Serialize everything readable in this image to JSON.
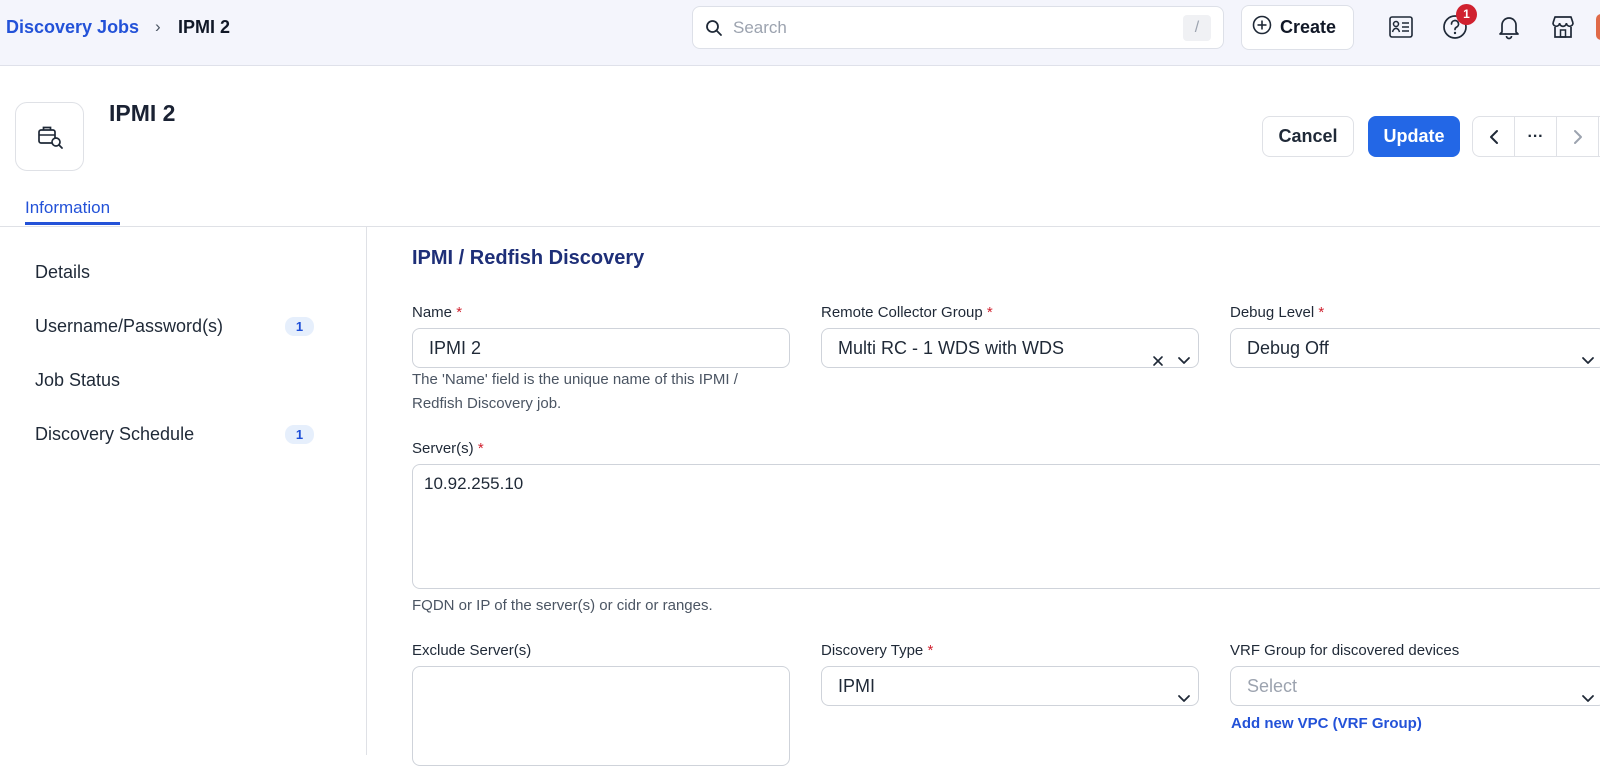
{
  "breadcrumb": {
    "root": "Discovery Jobs",
    "separator": "›",
    "current": "IPMI 2"
  },
  "search": {
    "placeholder": "Search",
    "shortcut": "/"
  },
  "header_actions": {
    "create_label": "Create",
    "help_badge": "1",
    "icons": [
      "report-icon",
      "help-icon",
      "bell-icon",
      "store-icon",
      "avatar"
    ]
  },
  "page": {
    "title": "IPMI 2",
    "cancel_label": "Cancel",
    "update_label": "Update",
    "more_label": "···"
  },
  "tabs": [
    {
      "label": "Information",
      "active": true
    }
  ],
  "sidebar": {
    "items": [
      {
        "label": "Details",
        "count": ""
      },
      {
        "label": "Username/Password(s)",
        "count": "1"
      },
      {
        "label": "Job Status",
        "count": ""
      },
      {
        "label": "Discovery Schedule",
        "count": "1"
      }
    ]
  },
  "form": {
    "section_title": "IPMI / Redfish Discovery",
    "required_mark": "*",
    "name": {
      "label": "Name",
      "value": "IPMI 2",
      "help": "The 'Name' field is the unique name of this IPMI /",
      "help2": "Redfish Discovery job."
    },
    "remote_collector_group": {
      "label": "Remote Collector Group",
      "value": "Multi RC - 1 WDS with WDS"
    },
    "debug_level": {
      "label": "Debug Level",
      "value": "Debug Off"
    },
    "servers": {
      "label": "Server(s)",
      "value": "10.92.255.10",
      "help": "FQDN or IP of the server(s) or cidr or ranges."
    },
    "exclude_servers": {
      "label": "Exclude Server(s)",
      "value": ""
    },
    "discovery_type": {
      "label": "Discovery Type",
      "value": "IPMI"
    },
    "vrf_group": {
      "label": "VRF Group for discovered devices",
      "placeholder": "Select",
      "add_link": "Add new VPC (VRF Group)"
    }
  },
  "colors": {
    "accent": "#2367e6",
    "link": "#2352d8",
    "required": "#d0212f",
    "section_title": "#1e2f78"
  }
}
